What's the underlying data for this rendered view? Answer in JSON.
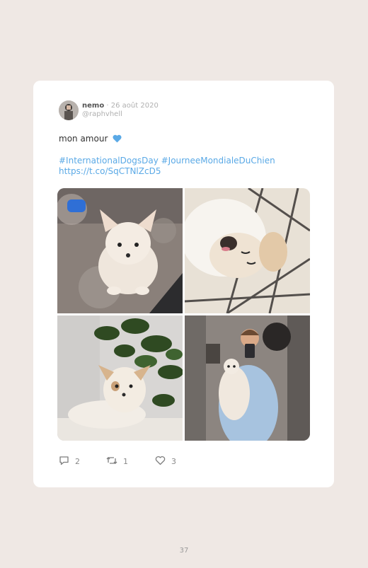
{
  "tweet": {
    "author_name": "nemo",
    "separator": "·",
    "date": "26 août 2020",
    "handle": "@raphvhell",
    "text": "mon amour",
    "hashtags": "#InternationalDogsDay #JourneeMondialeDuChien",
    "link": "https://t.co/SqCTNlZcD5",
    "replies": "2",
    "retweets": "1",
    "likes": "3"
  },
  "icons": {
    "avatar": "avatar-photo",
    "emoji": "blue-heart-icon",
    "reply": "comment-icon",
    "retweet": "retweet-icon",
    "like": "heart-icon"
  },
  "colors": {
    "background": "#efe8e4",
    "card": "#ffffff",
    "link": "#5aa9e6",
    "heart_emoji": "#5aa9e6"
  },
  "page": {
    "number": "37"
  }
}
